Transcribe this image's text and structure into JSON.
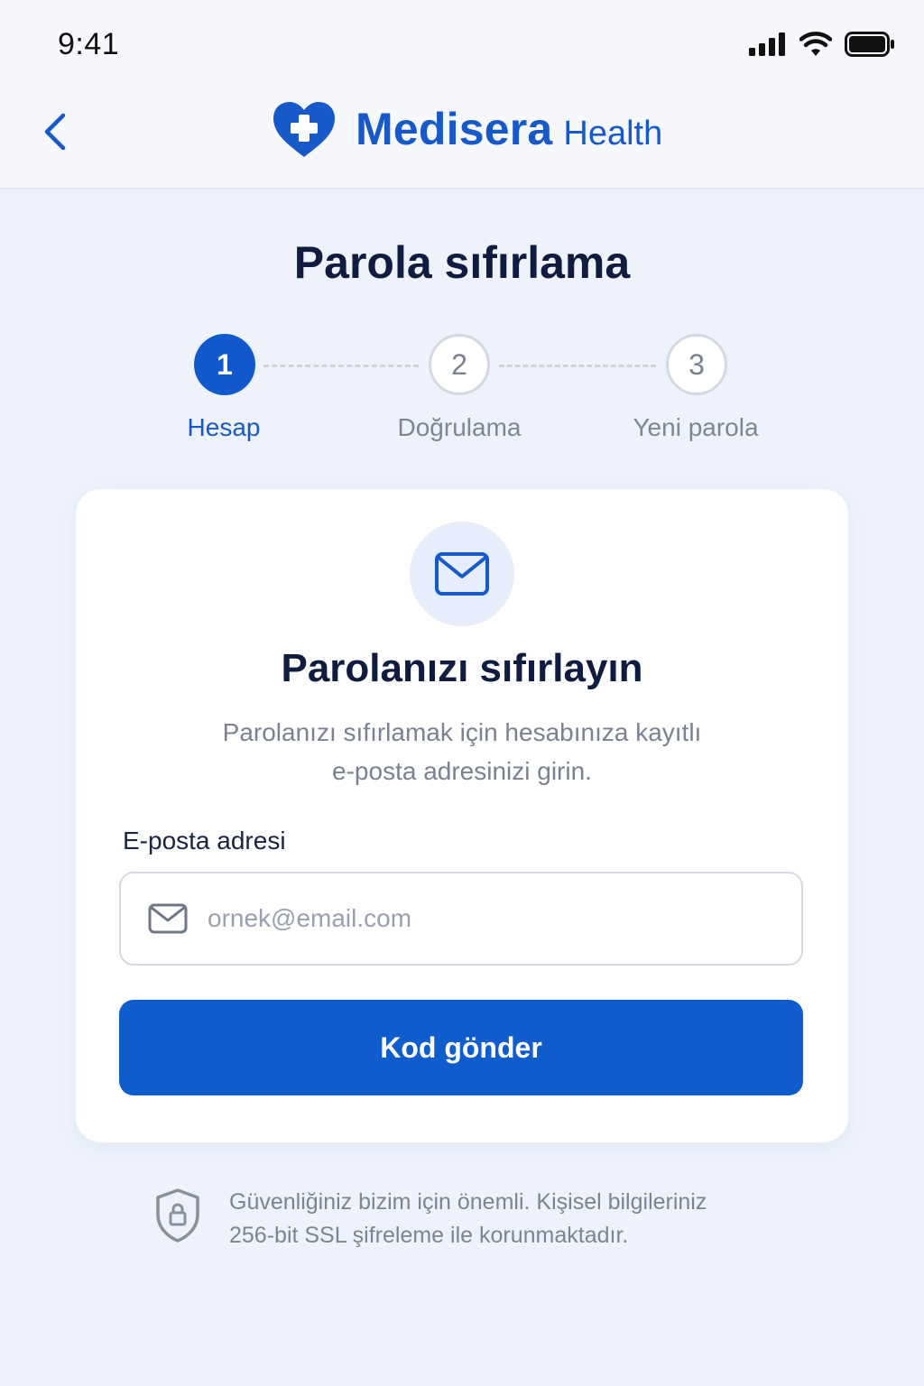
{
  "status_bar": {
    "time": "9:41"
  },
  "header": {
    "brand_name": "Medisera",
    "brand_suffix": "Health"
  },
  "page": {
    "title": "Parola sıfırlama"
  },
  "stepper": {
    "steps": [
      {
        "number": "1",
        "label": "Hesap",
        "state": "active"
      },
      {
        "number": "2",
        "label": "Doğrulama",
        "state": "inactive"
      },
      {
        "number": "3",
        "label": "Yeni parola",
        "state": "inactive"
      }
    ]
  },
  "card": {
    "icon": "mail-icon",
    "title": "Parolanızı sıfırlayın",
    "description_line1": "Parolanızı sıfırlamak için hesabınıza kayıtlı",
    "description_line2": "e-posta adresinizi girin.",
    "email_label": "E-posta adresi",
    "email_value": "",
    "email_placeholder": "ornek@email.com",
    "submit_label": "Kod gönder"
  },
  "security": {
    "icon": "shield-lock-icon",
    "line1": "Güvenliğiniz bizim için önemli. Kişisel bilgileriniz",
    "line2": "256-bit SSL şifreleme ile korunmaktadır."
  },
  "colors": {
    "primary": "#0f5ccc",
    "brand": "#1859c9",
    "background": "#eef3fb",
    "card": "#ffffff",
    "text_dark": "#0f1c3f",
    "text_muted": "#7a8190"
  }
}
